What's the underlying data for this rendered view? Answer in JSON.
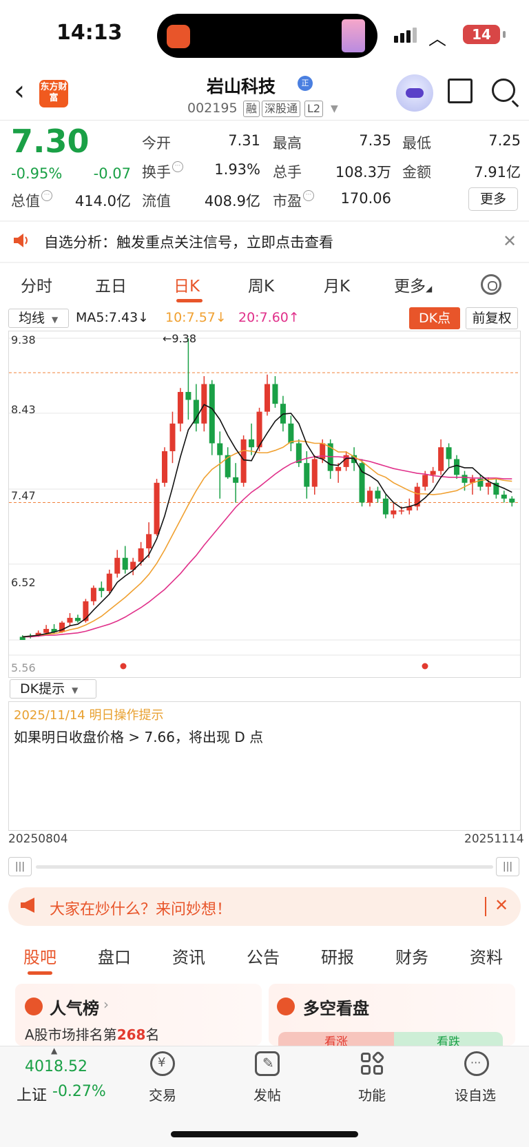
{
  "status": {
    "time": "14:13",
    "battery": "14"
  },
  "header": {
    "brand": "东方财富",
    "title": "岩山科技",
    "title_badge": "正",
    "code": "002195",
    "tags": [
      "融",
      "深股通",
      "L2"
    ]
  },
  "quote": {
    "price": "7.30",
    "change_pct": "-0.95%",
    "change": "-0.07",
    "fields": [
      {
        "label": "今开",
        "value": "7.31",
        "color": "green"
      },
      {
        "label": "最高",
        "value": "7.35",
        "color": "green"
      },
      {
        "label": "最低",
        "value": "7.25",
        "color": "green"
      },
      {
        "label": "换手",
        "value": "1.93%",
        "color": "plain"
      },
      {
        "label": "总手",
        "value": "108.3万",
        "color": "plain"
      },
      {
        "label": "金额",
        "value": "7.91亿",
        "color": "plain"
      },
      {
        "label": "总值",
        "value": "414.0亿",
        "color": "plain"
      },
      {
        "label": "流值",
        "value": "408.9亿",
        "color": "plain"
      },
      {
        "label": "市盈",
        "value": "170.06",
        "color": "plain"
      }
    ],
    "more": "更多"
  },
  "banner": {
    "text": "自选分析：触发重点关注信号，立即点击查看"
  },
  "kline_tabs": [
    "分时",
    "五日",
    "日K",
    "周K",
    "月K",
    "更多"
  ],
  "active_tab": "日K",
  "indicator": {
    "select": "均线",
    "ma5": "MA5:7.43↓",
    "ma10": "10:7.57↓",
    "ma20": "20:7.60↑",
    "dk_button": "DK点",
    "adjust_button": "前复权"
  },
  "chart_data": {
    "type": "candlestick",
    "y_ticks": [
      "9.38",
      "8.43",
      "7.47",
      "6.52",
      "5.56"
    ],
    "ylim": [
      5.56,
      9.38
    ],
    "high_marker": "←9.38",
    "low_marker": "5.56",
    "dates": [
      "20250804",
      "20251114"
    ],
    "colors": {
      "up": "#e23a2f",
      "down": "#1aa046",
      "ma5": "#111111",
      "ma10": "#f0a030",
      "ma20": "#e0308a"
    },
    "ohlc": [
      [
        5.6,
        5.62,
        5.57,
        5.56
      ],
      [
        5.61,
        5.64,
        5.58,
        5.6
      ],
      [
        5.62,
        5.68,
        5.6,
        5.65
      ],
      [
        5.65,
        5.75,
        5.63,
        5.7
      ],
      [
        5.7,
        5.76,
        5.64,
        5.66
      ],
      [
        5.66,
        5.8,
        5.65,
        5.78
      ],
      [
        5.78,
        5.9,
        5.74,
        5.84
      ],
      [
        5.84,
        5.88,
        5.78,
        5.8
      ],
      [
        5.8,
        6.08,
        5.78,
        6.05
      ],
      [
        6.05,
        6.25,
        6.0,
        6.22
      ],
      [
        6.22,
        6.3,
        6.1,
        6.18
      ],
      [
        6.18,
        6.45,
        6.15,
        6.4
      ],
      [
        6.4,
        6.7,
        6.35,
        6.6
      ],
      [
        6.6,
        6.75,
        6.4,
        6.45
      ],
      [
        6.45,
        6.6,
        6.38,
        6.55
      ],
      [
        6.55,
        6.8,
        6.5,
        6.72
      ],
      [
        6.72,
        7.05,
        6.6,
        6.9
      ],
      [
        6.9,
        7.6,
        6.88,
        7.55
      ],
      [
        7.55,
        8.0,
        7.5,
        7.95
      ],
      [
        7.95,
        8.45,
        7.8,
        8.3
      ],
      [
        8.3,
        8.75,
        8.2,
        8.7
      ],
      [
        8.7,
        9.38,
        8.35,
        8.6
      ],
      [
        8.6,
        8.8,
        8.2,
        8.3
      ],
      [
        8.3,
        8.9,
        8.2,
        8.8
      ],
      [
        8.8,
        8.85,
        7.9,
        8.05
      ],
      [
        8.05,
        8.2,
        7.35,
        7.9
      ],
      [
        7.9,
        8.0,
        7.6,
        7.62
      ],
      [
        7.62,
        7.8,
        7.3,
        7.55
      ],
      [
        7.55,
        8.15,
        7.5,
        8.1
      ],
      [
        8.1,
        8.3,
        7.9,
        8.0
      ],
      [
        8.0,
        8.5,
        7.95,
        8.45
      ],
      [
        8.45,
        8.92,
        8.4,
        8.8
      ],
      [
        8.8,
        8.9,
        8.5,
        8.55
      ],
      [
        8.55,
        8.65,
        8.2,
        8.3
      ],
      [
        8.3,
        8.4,
        7.95,
        8.05
      ],
      [
        8.05,
        8.1,
        7.75,
        7.8
      ],
      [
        7.8,
        7.95,
        7.35,
        7.5
      ],
      [
        7.5,
        7.9,
        7.4,
        7.85
      ],
      [
        7.85,
        8.1,
        7.8,
        8.05
      ],
      [
        8.05,
        8.1,
        7.6,
        7.7
      ],
      [
        7.7,
        7.8,
        7.55,
        7.75
      ],
      [
        7.75,
        7.95,
        7.7,
        7.9
      ],
      [
        7.9,
        8.0,
        7.7,
        7.8
      ],
      [
        7.8,
        7.85,
        7.25,
        7.3
      ],
      [
        7.3,
        7.5,
        7.25,
        7.45
      ],
      [
        7.45,
        7.5,
        7.3,
        7.35
      ],
      [
        7.35,
        7.4,
        7.1,
        7.15
      ],
      [
        7.15,
        7.3,
        7.1,
        7.2
      ],
      [
        7.2,
        7.25,
        7.15,
        7.2
      ],
      [
        7.2,
        7.35,
        7.15,
        7.25
      ],
      [
        7.25,
        7.55,
        7.2,
        7.5
      ],
      [
        7.5,
        7.7,
        7.45,
        7.65
      ],
      [
        7.65,
        7.75,
        7.55,
        7.7
      ],
      [
        7.7,
        8.1,
        7.65,
        8.0
      ],
      [
        8.0,
        8.05,
        7.75,
        7.85
      ],
      [
        7.85,
        7.9,
        7.6,
        7.65
      ],
      [
        7.65,
        7.7,
        7.45,
        7.55
      ],
      [
        7.55,
        7.65,
        7.4,
        7.6
      ],
      [
        7.6,
        7.65,
        7.45,
        7.5
      ],
      [
        7.5,
        7.62,
        7.4,
        7.55
      ],
      [
        7.55,
        7.6,
        7.35,
        7.4
      ],
      [
        7.4,
        7.45,
        7.3,
        7.35
      ],
      [
        7.35,
        7.38,
        7.25,
        7.3
      ]
    ],
    "ma5": [
      5.6,
      5.61,
      5.62,
      5.64,
      5.66,
      5.69,
      5.74,
      5.76,
      5.83,
      5.94,
      6.04,
      6.14,
      6.29,
      6.37,
      6.44,
      6.54,
      6.64,
      6.84,
      7.13,
      7.49,
      7.88,
      8.22,
      8.37,
      8.54,
      8.49,
      8.35,
      8.15,
      7.98,
      7.84,
      7.83,
      8.02,
      8.18,
      8.33,
      8.42,
      8.43,
      8.3,
      8.04,
      7.88,
      7.85,
      7.78,
      7.77,
      7.86,
      7.86,
      7.69,
      7.64,
      7.57,
      7.41,
      7.3,
      7.23,
      7.25,
      7.28,
      7.36,
      7.46,
      7.62,
      7.74,
      7.77,
      7.74,
      7.74,
      7.65,
      7.57,
      7.52,
      7.48,
      7.43
    ],
    "ma10": [
      5.6,
      5.61,
      5.62,
      5.63,
      5.64,
      5.66,
      5.69,
      5.71,
      5.75,
      5.8,
      5.86,
      5.94,
      6.02,
      6.1,
      6.19,
      6.28,
      6.39,
      6.53,
      6.7,
      6.89,
      7.08,
      7.27,
      7.45,
      7.61,
      7.72,
      7.79,
      7.87,
      7.92,
      7.96,
      7.95,
      7.93,
      7.93,
      7.96,
      8.0,
      8.07,
      8.08,
      8.07,
      8.05,
      8.05,
      8.0,
      7.94,
      7.94,
      7.88,
      7.82,
      7.74,
      7.66,
      7.62,
      7.55,
      7.5,
      7.45,
      7.41,
      7.41,
      7.4,
      7.41,
      7.43,
      7.45,
      7.5,
      7.55,
      7.58,
      7.59,
      7.6,
      7.58,
      7.57
    ],
    "ma20": [
      5.6,
      5.6,
      5.61,
      5.62,
      5.62,
      5.63,
      5.64,
      5.65,
      5.67,
      5.7,
      5.73,
      5.76,
      5.8,
      5.85,
      5.91,
      5.97,
      6.04,
      6.12,
      6.2,
      6.3,
      6.4,
      6.52,
      6.63,
      6.76,
      6.88,
      7.0,
      7.12,
      7.24,
      7.34,
      7.43,
      7.5,
      7.58,
      7.66,
      7.73,
      7.79,
      7.83,
      7.86,
      7.88,
      7.89,
      7.88,
      7.88,
      7.87,
      7.86,
      7.84,
      7.82,
      7.79,
      7.76,
      7.73,
      7.71,
      7.69,
      7.67,
      7.66,
      7.64,
      7.63,
      7.62,
      7.62,
      7.62,
      7.61,
      7.61,
      7.61,
      7.61,
      7.6,
      7.6
    ]
  },
  "dk": {
    "select": "DK提示",
    "date_line": "2025/11/14 明日操作提示",
    "hint": "如果明日收盘价格 > 7.66，将出现 D 点"
  },
  "promo": {
    "text": "大家在炒什么？来问妙想！"
  },
  "bottom_tabs": [
    "股吧",
    "盘口",
    "资讯",
    "公告",
    "研报",
    "财务",
    "资料"
  ],
  "cards": {
    "popular": {
      "title": "人气榜",
      "sub_prefix": "A股市场排名第",
      "rank": "268",
      "sub_suffix": "名"
    },
    "bullbear": {
      "title": "多空看盘",
      "up": "看涨",
      "down": "看跌"
    }
  },
  "bottom_nav": {
    "index_value": "4018.52",
    "index_name": "上证",
    "index_change": "-0.27%",
    "items": [
      "交易",
      "发帖",
      "功能",
      "设自选"
    ]
  }
}
